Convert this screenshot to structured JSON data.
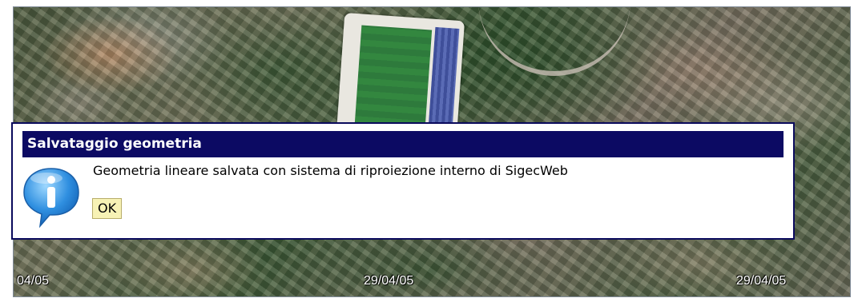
{
  "map": {
    "date_labels": [
      "04/05",
      "29/04/05",
      "29/04/05"
    ]
  },
  "dialog": {
    "title": "Salvataggio geometria",
    "message": "Geometria lineare salvata con sistema di riproiezione interno di SigecWeb",
    "ok_label": "OK",
    "icon": "info-icon",
    "header_color": "#0c0a63",
    "button_color": "#f7f2b5"
  }
}
